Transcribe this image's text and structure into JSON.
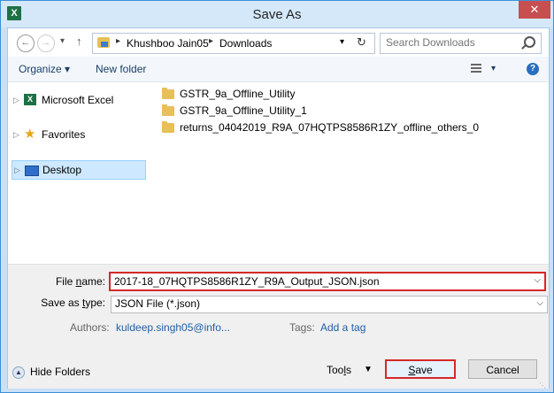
{
  "window": {
    "title": "Save As",
    "app_icon": "excel-icon",
    "close_label": "✕"
  },
  "nav": {
    "back_glyph": "←",
    "forward_glyph": "→",
    "dropdown_glyph": "▾",
    "up_glyph": "↑",
    "breadcrumbs": [
      "Khushboo Jain05",
      "Downloads"
    ],
    "refresh_glyph": "↻",
    "search_placeholder": "Search Downloads"
  },
  "toolbar": {
    "organize": "Organize ▾",
    "new_folder": "New folder",
    "help": "?"
  },
  "sidebar": {
    "items": [
      {
        "label": "Microsoft Excel",
        "icon": "excel-icon"
      },
      {
        "label": "Favorites",
        "icon": "star-icon"
      },
      {
        "label": "Desktop",
        "icon": "desktop-icon"
      }
    ]
  },
  "files": [
    {
      "name": "GSTR_9a_Offline_Utility"
    },
    {
      "name": "GSTR_9a_Offline_Utility_1"
    },
    {
      "name": "returns_04042019_R9A_07HQTPS8586R1ZY_offline_others_0"
    }
  ],
  "form": {
    "file_name_label_pre": "File ",
    "file_name_label_u": "n",
    "file_name_label_post": "ame:",
    "file_name_value": "2017-18_07HQTPS8586R1ZY_R9A_Output_JSON.json",
    "save_type_label_pre": "Save as ",
    "save_type_label_u": "t",
    "save_type_label_post": "ype:",
    "save_type_value": "JSON File (*.json)",
    "authors_label": "Authors:",
    "authors_value": "kuldeep.singh05@info...",
    "tags_label": "Tags:",
    "tags_value": "Add a tag"
  },
  "footer": {
    "hide_folders": "Hide Folders",
    "tools_pre": "Too",
    "tools_u": "l",
    "tools_post": "s",
    "save_u": "S",
    "save_post": "ave",
    "cancel": "Cancel"
  },
  "colors": {
    "accent": "#3c8fd8",
    "highlight": "#d62828",
    "link": "#1f5fa8",
    "selection": "#cde8ff"
  }
}
